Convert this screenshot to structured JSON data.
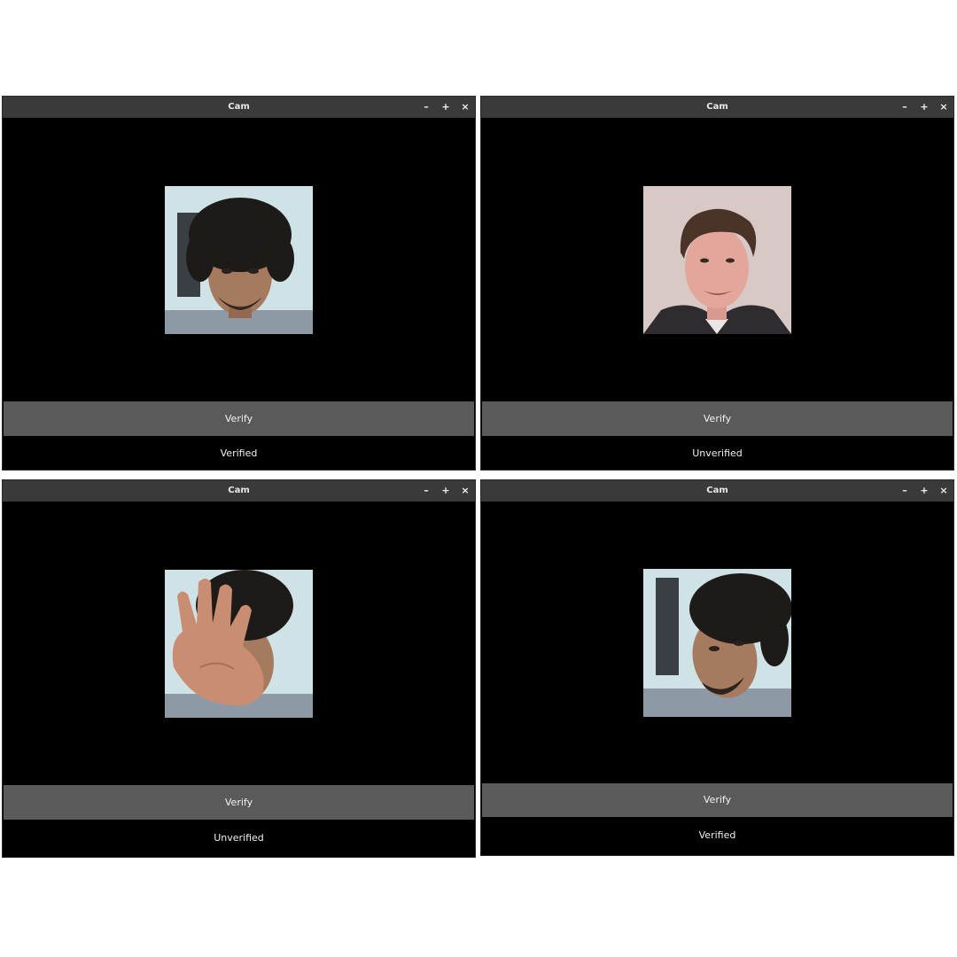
{
  "windows": [
    {
      "title": "Cam",
      "controls": {
        "minimize": "–",
        "maximize": "+",
        "close": "×"
      },
      "verify_label": "Verify",
      "status": "Verified"
    },
    {
      "title": "Cam",
      "controls": {
        "minimize": "–",
        "maximize": "+",
        "close": "×"
      },
      "verify_label": "Verify",
      "status": "Unverified"
    },
    {
      "title": "Cam",
      "controls": {
        "minimize": "–",
        "maximize": "+",
        "close": "×"
      },
      "verify_label": "Verify",
      "status": "Unverified"
    },
    {
      "title": "Cam",
      "controls": {
        "minimize": "–",
        "maximize": "+",
        "close": "×"
      },
      "verify_label": "Verify",
      "status": "Verified"
    }
  ],
  "colors": {
    "window_bg": "#000000",
    "titlebar_bg": "#3a3a3a",
    "button_bg": "#5a5a5a",
    "text": "#f2f2f2"
  }
}
